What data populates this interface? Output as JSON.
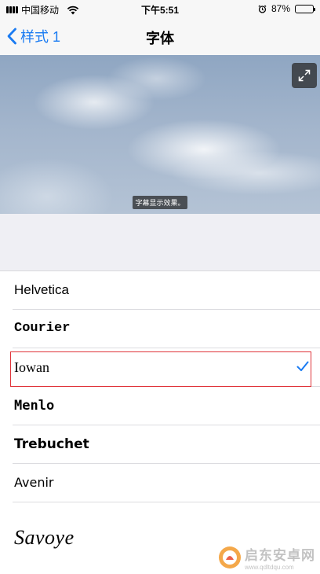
{
  "status_bar": {
    "carrier": "中国移动",
    "time": "下午5:51",
    "battery_percent": "87%",
    "battery_level": 0.87,
    "icons": [
      "signal-icon",
      "wifi-icon",
      "alarm-icon",
      "battery-icon"
    ]
  },
  "nav": {
    "back_label": "样式 1",
    "title": "字体"
  },
  "preview": {
    "subtitle_text": "字幕显示效果。",
    "expand_icon": "expand-icon"
  },
  "fonts": {
    "items": [
      {
        "label": "Helvetica",
        "selected": false
      },
      {
        "label": "Courier",
        "selected": false
      },
      {
        "label": "Iowan",
        "selected": true
      },
      {
        "label": "Menlo",
        "selected": false
      },
      {
        "label": "Trebuchet",
        "selected": false
      },
      {
        "label": "Avenir",
        "selected": false
      },
      {
        "label": "Savoye",
        "selected": false
      }
    ]
  },
  "watermark": {
    "title": "启东安卓网",
    "url": "www.qdltdqu.com"
  },
  "colors": {
    "accent": "#1a7bf2",
    "highlight_border": "#e0343a"
  }
}
